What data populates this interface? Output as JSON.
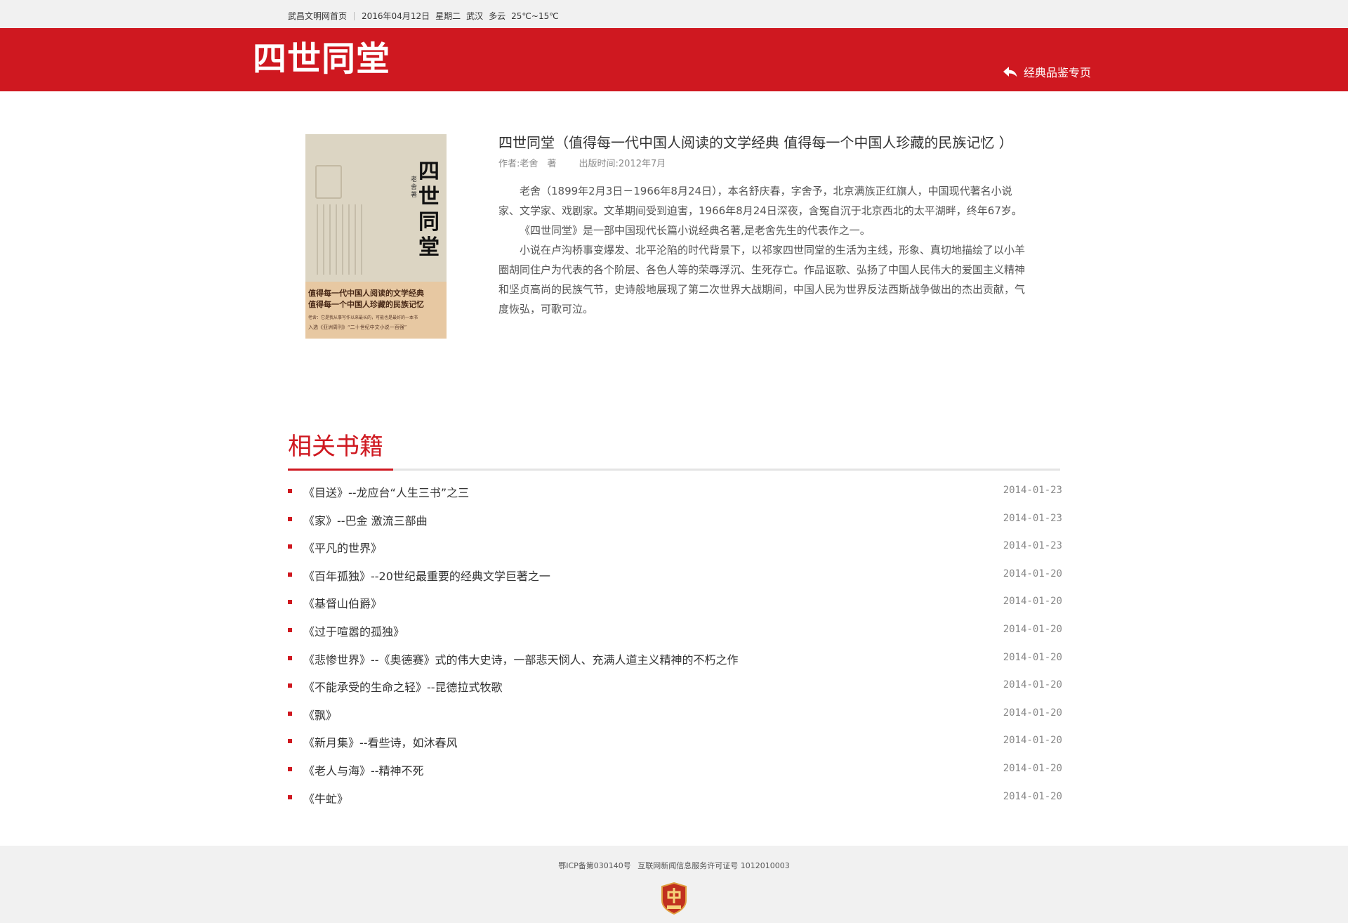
{
  "topbar": {
    "home_link": "武昌文明网首页",
    "date": "2016年04月12日",
    "weekday": "星期二",
    "city": "武汉",
    "weather": "多云",
    "temperature": "25℃~15℃"
  },
  "header": {
    "site_title": "四世同堂",
    "back_link_label": "经典品鉴专页"
  },
  "book": {
    "cover": {
      "title": "四世同堂",
      "author": "老舍 著",
      "band_line1": "值得每一代中国人阅读的文学经典",
      "band_line2": "值得每一个中国人珍藏的民族记忆",
      "band_line3": "老舍：它是我从事写作以来最长的，可能也是最好的一本书",
      "band_line4": "入选《亚洲周刊》“二十世纪中文小说一百强”"
    },
    "title": "四世同堂（值得每一代中国人阅读的文学经典 值得每一个中国人珍藏的民族记忆 ）",
    "author": "作者:老舍　著",
    "publish_date": "出版时间:2012年7月",
    "paragraphs": [
      "老舍（1899年2月3日－1966年8月24日），本名舒庆春，字舍予，北京满族正红旗人，中国现代著名小说家、文学家、戏剧家。文革期间受到迫害，1966年8月24日深夜，含冤自沉于北京西北的太平湖畔，终年67岁。",
      "《四世同堂》是一部中国现代长篇小说经典名著,是老舍先生的代表作之一。",
      "小说在卢沟桥事变爆发、北平沦陷的时代背景下，以祁家四世同堂的生活为主线，形象、真切地描绘了以小羊圈胡同住户为代表的各个阶层、各色人等的荣辱浮沉、生死存亡。作品讴歌、弘扬了中国人民伟大的爱国主义精神和坚贞高尚的民族气节，史诗般地展现了第二次世界大战期间，中国人民为世界反法西斯战争做出的杰出贡献，气度恢弘，可歌可泣。"
    ]
  },
  "related": {
    "heading": "相关书籍",
    "items": [
      {
        "title": "《目送》--龙应台“人生三书”之三",
        "date": "2014-01-23"
      },
      {
        "title": "《家》--巴金 激流三部曲",
        "date": "2014-01-23"
      },
      {
        "title": "《平凡的世界》",
        "date": "2014-01-23"
      },
      {
        "title": "《百年孤独》--20世纪最重要的经典文学巨著之一",
        "date": "2014-01-20"
      },
      {
        "title": "《基督山伯爵》",
        "date": "2014-01-20"
      },
      {
        "title": "《过于喧嚣的孤独》",
        "date": "2014-01-20"
      },
      {
        "title": "《悲惨世界》--《奥德赛》式的伟大史诗，一部悲天悯人、充满人道主义精神的不朽之作",
        "date": "2014-01-20"
      },
      {
        "title": "《不能承受的生命之轻》--昆德拉式牧歌",
        "date": "2014-01-20"
      },
      {
        "title": "《飘》",
        "date": "2014-01-20"
      },
      {
        "title": "《新月集》--看些诗，如沐春风",
        "date": "2014-01-20"
      },
      {
        "title": "《老人与海》--精神不死",
        "date": "2014-01-20"
      },
      {
        "title": "《牛虻》",
        "date": "2014-01-20"
      }
    ]
  },
  "footer": {
    "icp": "鄂ICP备第030140号",
    "license": "互联网新闻信息服务许可证号 1012010003",
    "badge_icon": "government-badge-icon"
  },
  "colors": {
    "brand_red": "#cf1820",
    "topbar_bg": "#f1f1f1",
    "footer_bg": "#f1f1f1"
  }
}
